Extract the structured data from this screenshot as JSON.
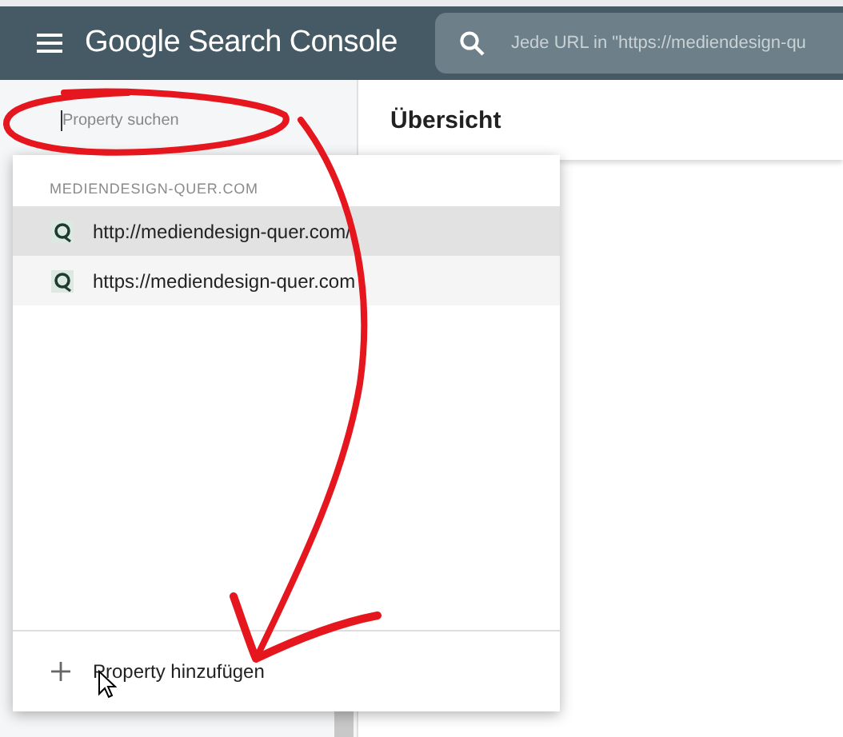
{
  "header": {
    "title": "Google Search Console",
    "search_placeholder": "Jede URL in \"https://mediendesign-qu"
  },
  "sidebar": {
    "search": {
      "placeholder": "Property suchen"
    }
  },
  "main": {
    "title": "Übersicht"
  },
  "dropdown": {
    "group": "MEDIENDESIGN-QUER.COM",
    "items": [
      {
        "label": "http://mediendesign-quer.com/",
        "selected": true
      },
      {
        "label": "https://mediendesign-quer.com",
        "selected": false
      }
    ],
    "add_label": "Property hinzufügen"
  }
}
